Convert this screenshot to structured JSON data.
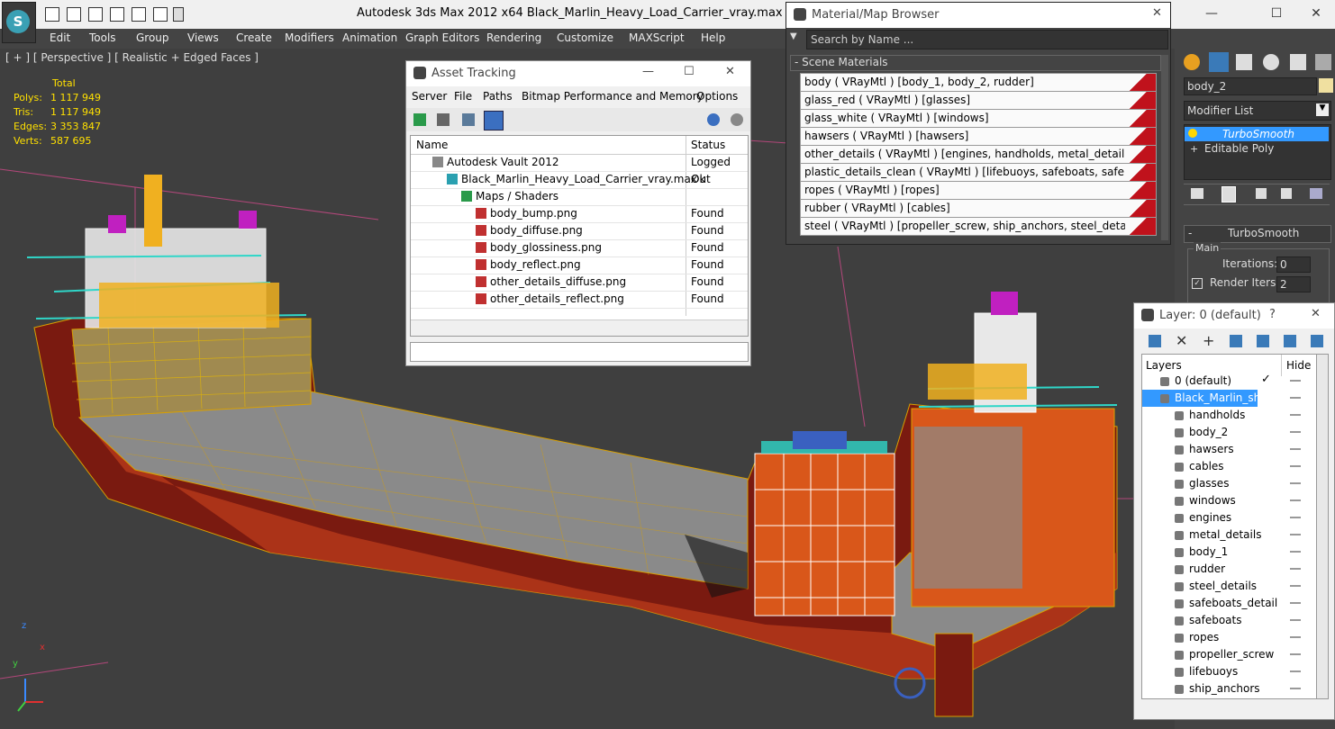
{
  "window": {
    "title": "Autodesk 3ds Max  2012 x64      Black_Marlin_Heavy_Load_Carrier_vray.max",
    "app_logo": "3ds-max-logo",
    "controls": [
      "—",
      "☐",
      "✕"
    ]
  },
  "menubar": {
    "items": [
      "Edit",
      "Tools",
      "Group",
      "Views",
      "Create",
      "Modifiers",
      "Animation",
      "Graph Editors",
      "Rendering",
      "Customize",
      "MAXScript",
      "Help"
    ]
  },
  "viewport": {
    "label": "[ + ] [ Perspective ] [ Realistic + Edged Faces ]",
    "stats_header": "Total",
    "stats": [
      {
        "label": "Polys:",
        "value": "1 117 949"
      },
      {
        "label": "Tris:",
        "value": "1 117 949"
      },
      {
        "label": "Edges:",
        "value": "3 353 847"
      },
      {
        "label": "Verts:",
        "value": "587 695"
      }
    ],
    "axis_labels": [
      "x",
      "y",
      "z"
    ]
  },
  "asset_tracking": {
    "title": "Asset Tracking",
    "menu": [
      "Server",
      "File",
      "Paths",
      "Bitmap Performance and Memory",
      "Options"
    ],
    "columns": [
      "Name",
      "Status"
    ],
    "rows": [
      {
        "name": "Autodesk Vault 2012",
        "status": "Logged Out",
        "indent": 0,
        "icon": "vault-icon"
      },
      {
        "name": "Black_Marlin_Heavy_Load_Carrier_vray.max",
        "status": "Ok",
        "indent": 1,
        "icon": "max-file-icon"
      },
      {
        "name": "Maps / Shaders",
        "status": "",
        "indent": 2,
        "icon": "maps-icon"
      },
      {
        "name": "body_bump.png",
        "status": "Found",
        "indent": 3,
        "icon": "png-icon"
      },
      {
        "name": "body_diffuse.png",
        "status": "Found",
        "indent": 3,
        "icon": "png-icon"
      },
      {
        "name": "body_glossiness.png",
        "status": "Found",
        "indent": 3,
        "icon": "png-icon"
      },
      {
        "name": "body_reflect.png",
        "status": "Found",
        "indent": 3,
        "icon": "png-icon"
      },
      {
        "name": "other_details_diffuse.png",
        "status": "Found",
        "indent": 3,
        "icon": "png-icon"
      },
      {
        "name": "other_details_reflect.png",
        "status": "Found",
        "indent": 3,
        "icon": "png-icon"
      }
    ]
  },
  "material_browser": {
    "title": "Material/Map Browser",
    "search_placeholder": "Search by Name ...",
    "section": "- Scene Materials",
    "materials": [
      "body  ( VRayMtl ) [body_1, body_2, rudder]",
      "glass_red  ( VRayMtl ) [glasses]",
      "glass_white  ( VRayMtl ) [windows]",
      "hawsers  ( VRayMtl ) [hawsers]",
      "other_details  ( VRayMtl ) [engines, handholds, metal_details]",
      "plastic_details_clean  ( VRayMtl ) [lifebuoys, safeboats, safeboats_details]",
      "ropes  ( VRayMtl ) [ropes]",
      "rubber  ( VRayMtl ) [cables]",
      "steel  ( VRayMtl ) [propeller_screw, ship_anchors, steel_details]"
    ]
  },
  "command_panel": {
    "object_name": "body_2",
    "modifier_list": "Modifier List",
    "stack": [
      "TurboSmooth",
      "Editable Poly"
    ],
    "rollout_title": "TurboSmooth",
    "group": "Main",
    "iterations_label": "Iterations:",
    "iterations_value": "0",
    "render_iters_label": "Render Iters:",
    "render_iters_value": "2"
  },
  "layer_panel": {
    "title": "Layer: 0 (default)",
    "help": "?",
    "columns": [
      "Layers",
      "Hide"
    ],
    "rows": [
      {
        "name": "0 (default)",
        "level": 0,
        "checked": true
      },
      {
        "name": "Black_Marlin_ship",
        "level": 0,
        "selected": true
      },
      {
        "name": "handholds",
        "level": 1
      },
      {
        "name": "body_2",
        "level": 1
      },
      {
        "name": "hawsers",
        "level": 1
      },
      {
        "name": "cables",
        "level": 1
      },
      {
        "name": "glasses",
        "level": 1
      },
      {
        "name": "windows",
        "level": 1
      },
      {
        "name": "engines",
        "level": 1
      },
      {
        "name": "metal_details",
        "level": 1
      },
      {
        "name": "body_1",
        "level": 1
      },
      {
        "name": "rudder",
        "level": 1
      },
      {
        "name": "steel_details",
        "level": 1
      },
      {
        "name": "safeboats_detail",
        "level": 1
      },
      {
        "name": "safeboats",
        "level": 1
      },
      {
        "name": "ropes",
        "level": 1
      },
      {
        "name": "propeller_screw",
        "level": 1
      },
      {
        "name": "lifebuoys",
        "level": 1
      },
      {
        "name": "ship_anchors",
        "level": 1
      }
    ]
  },
  "colors": {
    "stats_yellow": "#ffe000",
    "selection_blue": "#3399ff",
    "hull_red": "#8a1f12",
    "hull_orange": "#d9571a",
    "wire_yellow": "#e6b800",
    "cyan": "#2fd6c8"
  }
}
